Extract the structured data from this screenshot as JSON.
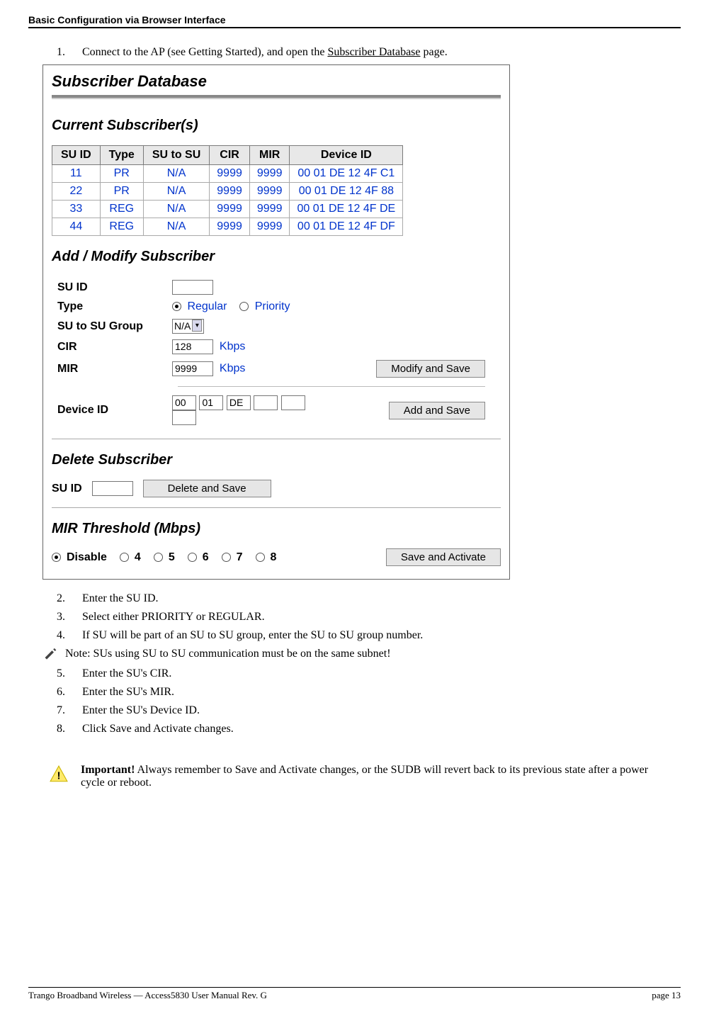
{
  "header": {
    "title": "Basic Configuration via Browser Interface"
  },
  "step1": {
    "num": "1.",
    "pre": "Connect to the AP (see Getting Started), and open the ",
    "link": "Subscriber Database",
    "post": " page."
  },
  "screenshot": {
    "title": "Subscriber Database",
    "current_h": "Current Subscriber(s)",
    "table": {
      "headers": [
        "SU ID",
        "Type",
        "SU to SU",
        "CIR",
        "MIR",
        "Device ID"
      ],
      "rows": [
        [
          "11",
          "PR",
          "N/A",
          "9999",
          "9999",
          "00 01 DE 12 4F C1"
        ],
        [
          "22",
          "PR",
          "N/A",
          "9999",
          "9999",
          "00 01 DE 12 4F 88"
        ],
        [
          "33",
          "REG",
          "N/A",
          "9999",
          "9999",
          "00 01 DE 12 4F DE"
        ],
        [
          "44",
          "REG",
          "N/A",
          "9999",
          "9999",
          "00 01 DE 12 4F DF"
        ]
      ]
    },
    "addmod_h": "Add / Modify Subscriber",
    "form": {
      "su_id_label": "SU ID",
      "su_id_value": "",
      "type_label": "Type",
      "type_regular": "Regular",
      "type_priority": "Priority",
      "s2s_label": "SU to SU Group",
      "s2s_value": "N/A",
      "cir_label": "CIR",
      "cir_value": "128",
      "cir_unit": "Kbps",
      "mir_label": "MIR",
      "mir_value": "9999",
      "mir_unit": "Kbps",
      "modify_btn": "Modify and Save",
      "device_label": "Device ID",
      "dev": [
        "00",
        "01",
        "DE",
        "",
        "",
        ""
      ],
      "add_btn": "Add and Save"
    },
    "delete_h": "Delete Subscriber",
    "delete": {
      "su_id_label": "SU ID",
      "su_id_value": "",
      "delete_btn": "Delete and Save"
    },
    "mirthresh_h": "MIR Threshold (Mbps)",
    "mir_opts": {
      "disable": "Disable",
      "o4": "4",
      "o5": "5",
      "o6": "6",
      "o7": "7",
      "o8": "8",
      "save_btn": "Save and Activate"
    }
  },
  "step2": {
    "num": "2.",
    "text": "Enter the SU ID."
  },
  "step3": {
    "num": "3.",
    "text": "Select either PRIORITY or REGULAR."
  },
  "step4": {
    "num": "4.",
    "text": "If SU will be part of an SU to SU group, enter the SU to SU group number."
  },
  "note": {
    "label": "Note:",
    "text": "SUs using SU to SU communication must be on the same subnet!"
  },
  "step5": {
    "num": "5.",
    "text": "Enter the SU's CIR."
  },
  "step6": {
    "num": "6.",
    "text": "Enter the SU's MIR."
  },
  "step7": {
    "num": "7.",
    "text": "Enter the SU's Device ID."
  },
  "step8": {
    "num": "8.",
    "text": "Click Save and Activate changes."
  },
  "important": {
    "label": "Important!",
    "text": "  Always remember to Save and Activate changes, or the SUDB will revert back to its previous state after a power cycle or reboot."
  },
  "footer": {
    "left": "Trango Broadband Wireless — Access5830 User Manual  Rev. G",
    "right": "page 13"
  }
}
